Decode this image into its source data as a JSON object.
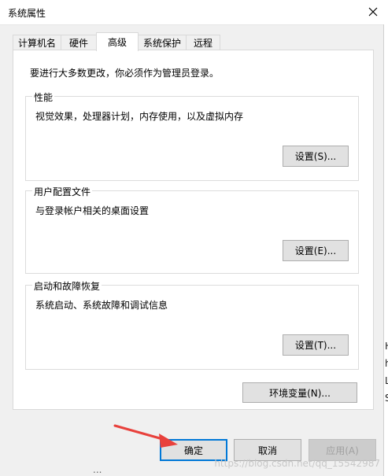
{
  "window": {
    "title": "系统属性"
  },
  "tabs": [
    {
      "label": "计算机名"
    },
    {
      "label": "硬件"
    },
    {
      "label": "高级",
      "active": true
    },
    {
      "label": "系统保护"
    },
    {
      "label": "远程"
    }
  ],
  "panel": {
    "intro": "要进行大多数更改，你必须作为管理员登录。",
    "performance": {
      "title": "性能",
      "desc": "视觉效果，处理器计划，内存使用，以及虚拟内存",
      "button": "设置(S)..."
    },
    "user_profiles": {
      "title": "用户配置文件",
      "desc": "与登录帐户相关的桌面设置",
      "button": "设置(E)..."
    },
    "startup_recovery": {
      "title": "启动和故障恢复",
      "desc": "系统启动、系统故障和调试信息",
      "button": "设置(T)..."
    },
    "env_button": "环境变量(N)..."
  },
  "footer": {
    "ok": "确定",
    "cancel": "取消",
    "apply": "应用(A)"
  },
  "watermark": "https://blog.csdn.net/qq_15542987",
  "background_right_chars": [
    "H",
    "h",
    "L",
    "S"
  ],
  "colors": {
    "accent": "#0078d7",
    "arrow": "#e8413c"
  },
  "icons": {
    "close": "close-icon",
    "arrow": "red-arrow-annotation"
  }
}
